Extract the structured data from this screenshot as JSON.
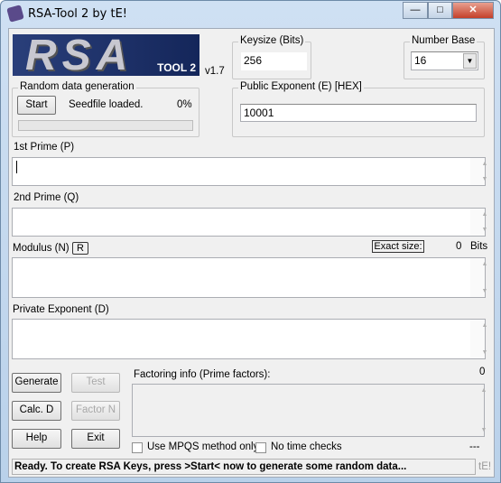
{
  "window": {
    "title": "RSA-Tool 2 by tE!",
    "minimize": "—",
    "maximize": "□",
    "close": "✕"
  },
  "logo": {
    "text": "RSA",
    "subtext": "TOOL 2",
    "version": "v1.7"
  },
  "keysize": {
    "label": "Keysize (Bits)",
    "value": "256"
  },
  "number_base": {
    "label": "Number Base",
    "value": "16"
  },
  "random": {
    "label": "Random data generation",
    "start": "Start",
    "status": "Seedfile loaded.",
    "percent": "0%",
    "progress": 0
  },
  "public_exponent": {
    "label": "Public Exponent (E) [HEX]",
    "value": "10001"
  },
  "prime_p": {
    "label": "1st Prime (P)",
    "value": ""
  },
  "prime_q": {
    "label": "2nd Prime (Q)",
    "value": ""
  },
  "modulus": {
    "label": "Modulus (N)",
    "r_button": "R",
    "exact_size_label": "Exact size:",
    "exact_size_value": "0",
    "unit": "Bits",
    "value": ""
  },
  "private_exponent": {
    "label": "Private Exponent (D)",
    "value": ""
  },
  "buttons": {
    "generate": "Generate",
    "test": "Test",
    "calc_d": "Calc. D",
    "factor_n": "Factor N",
    "help": "Help",
    "exit": "Exit"
  },
  "factoring": {
    "label": "Factoring info (Prime factors):",
    "count": "0",
    "value": "",
    "mpqs": "Use MPQS method only",
    "no_time": "No time checks",
    "timer": "---"
  },
  "status": {
    "text": "Ready. To create RSA Keys, press >Start< now to generate some random data...",
    "author": "tE!"
  }
}
